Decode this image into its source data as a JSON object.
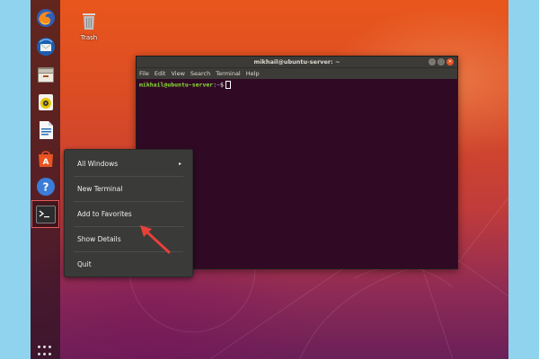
{
  "desktop": {
    "trash_label": "Trash"
  },
  "dock": {
    "items": [
      {
        "name": "firefox-icon",
        "active": false
      },
      {
        "name": "thunderbird-icon",
        "active": false
      },
      {
        "name": "files-icon",
        "active": false
      },
      {
        "name": "rhythmbox-icon",
        "active": false
      },
      {
        "name": "libreoffice-writer-icon",
        "active": false
      },
      {
        "name": "software-center-icon",
        "active": false
      },
      {
        "name": "help-icon",
        "active": false
      },
      {
        "name": "terminal-icon",
        "active": true
      }
    ]
  },
  "terminal": {
    "title": "mikhail@ubuntu-server: ~",
    "menu": [
      "File",
      "Edit",
      "View",
      "Search",
      "Terminal",
      "Help"
    ],
    "prompt_user": "mikhail@ubuntu-server",
    "prompt_sep": ":",
    "prompt_path": "~",
    "prompt_symbol": "$"
  },
  "context_menu": {
    "items": [
      {
        "label": "All Windows",
        "submenu": "▸"
      },
      {
        "label": "New Terminal"
      },
      {
        "label": "Add to Favorites"
      },
      {
        "label": "Show Details"
      },
      {
        "label": "Quit"
      }
    ]
  },
  "colors": {
    "accent": "#e95420",
    "terminal_bg": "#300a24",
    "annotation_arrow": "#e5413a",
    "frame": "#8fd3ee"
  }
}
